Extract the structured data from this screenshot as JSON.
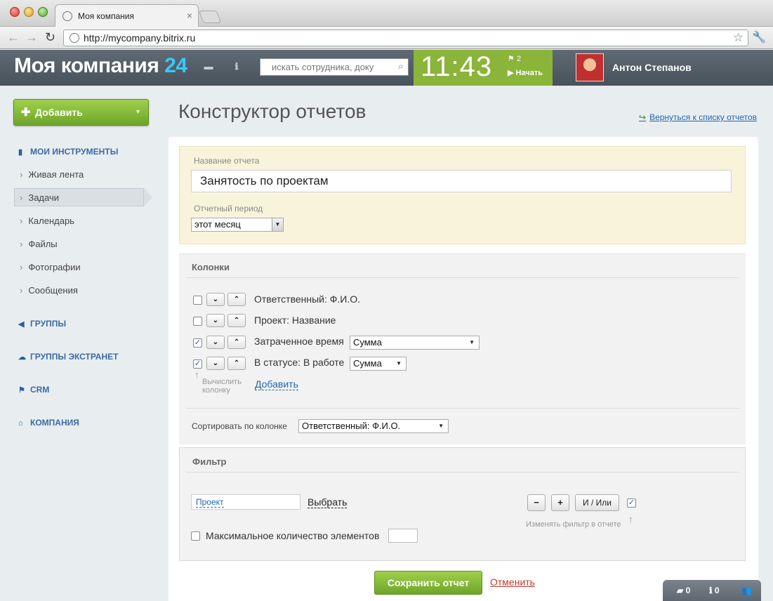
{
  "browser": {
    "tab_title": "Моя компания",
    "url": "http://mycompany.bitrix.ru"
  },
  "header": {
    "brand_name": "Моя компания",
    "brand_number": "24",
    "search_placeholder": "искать сотрудника, доку",
    "clock": "11:43",
    "flag_count": "2",
    "start_label": "Начать",
    "user_name": "Антон Степанов",
    "accent_color": "#3bc8f5",
    "clock_color": "#8ab43a"
  },
  "sidebar": {
    "add_button": "Добавить",
    "sections": [
      {
        "label": "МОИ ИНСТРУМЕНТЫ",
        "icon": "bookmark-icon"
      },
      {
        "label": "ГРУППЫ",
        "icon": "megaphone-icon"
      },
      {
        "label": "ГРУППЫ ЭКСТРАНЕТ",
        "icon": "cloud-icon"
      },
      {
        "label": "CRM",
        "icon": "crm-flag-icon"
      },
      {
        "label": "КОМПАНИЯ",
        "icon": "home-icon"
      }
    ],
    "items": [
      {
        "label": "Живая лента"
      },
      {
        "label": "Задачи",
        "active": true
      },
      {
        "label": "Календарь"
      },
      {
        "label": "Файлы"
      },
      {
        "label": "Фотографии"
      },
      {
        "label": "Сообщения"
      }
    ]
  },
  "page": {
    "title": "Конструктор отчетов",
    "back_link": "Вернуться к списку отчетов"
  },
  "report": {
    "name_label": "Название отчета",
    "name_value": "Занятость по проектам",
    "period_label": "Отчетный период",
    "period_value": "этот месяц"
  },
  "columns": {
    "heading": "Колонки",
    "rows": [
      {
        "label": "Ответственный: Ф.И.О.",
        "checked": false,
        "calc": ""
      },
      {
        "label": "Проект: Название",
        "checked": false,
        "calc": ""
      },
      {
        "label": "Затраченное время",
        "checked": true,
        "calc": "Сумма"
      },
      {
        "label": "В статусе: В работе",
        "checked": true,
        "calc": "Сумма"
      }
    ],
    "calc_hint_line1": "Вычислить",
    "calc_hint_line2": "колонку",
    "add_link": "Добавить",
    "sort_label": "Сортировать по колонке",
    "sort_value": "Ответственный: Ф.И.О."
  },
  "filter": {
    "heading": "Фильтр",
    "field_value": "Проект",
    "choose_link": "Выбрать",
    "minus": "−",
    "plus": "+",
    "and_or": "И / Или",
    "change_hint": "Изменять фильтр в отчете",
    "max_label": "Максимальное количество элементов",
    "max_value": ""
  },
  "actions": {
    "save": "Сохранить отчет",
    "cancel": "Отменить"
  },
  "bottombar": {
    "messages_count": "0",
    "notifications_count": "0"
  }
}
